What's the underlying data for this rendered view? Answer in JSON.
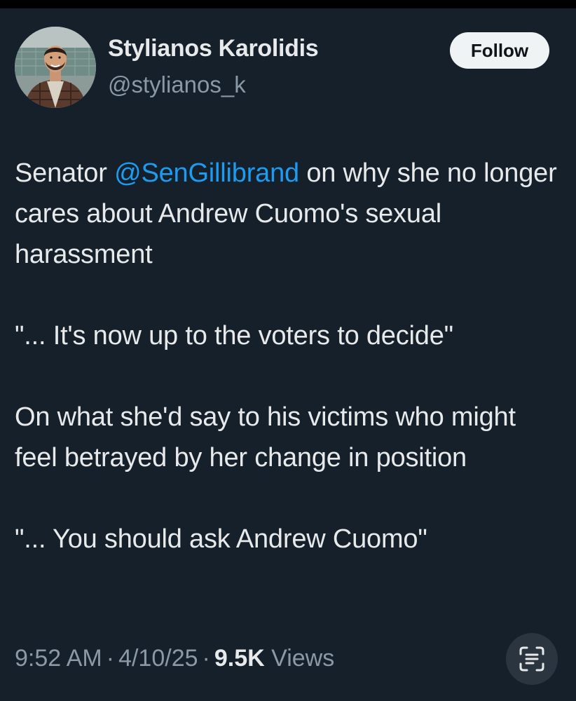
{
  "author": {
    "display_name": "Stylianos Karolidis",
    "handle": "@stylianos_k"
  },
  "follow_button": {
    "label": "Follow"
  },
  "tweet": {
    "paragraph1": {
      "prefix": "Senator ",
      "mention": "@SenGillibrand",
      "suffix": " on why she no longer cares about Andrew Cuomo's sexual harassment"
    },
    "paragraph2": "\"... It's now up to the voters to decide\"",
    "paragraph3": "On what she'd say to his victims who might feel betrayed by her change in position",
    "paragraph4": "\"... You should ask Andrew Cuomo\""
  },
  "meta": {
    "time": "9:52 AM",
    "separator": "·",
    "date": "4/10/25",
    "views_count": "9.5K",
    "views_label": "Views"
  },
  "icons": {
    "avatar": "profile-photo",
    "scan": "text-scan-icon"
  },
  "colors": {
    "background": "#15202b",
    "text": "#e7e9ea",
    "secondary_text": "#8b98a5",
    "link": "#1d9bf0",
    "follow_button_bg": "#eff3f4"
  }
}
